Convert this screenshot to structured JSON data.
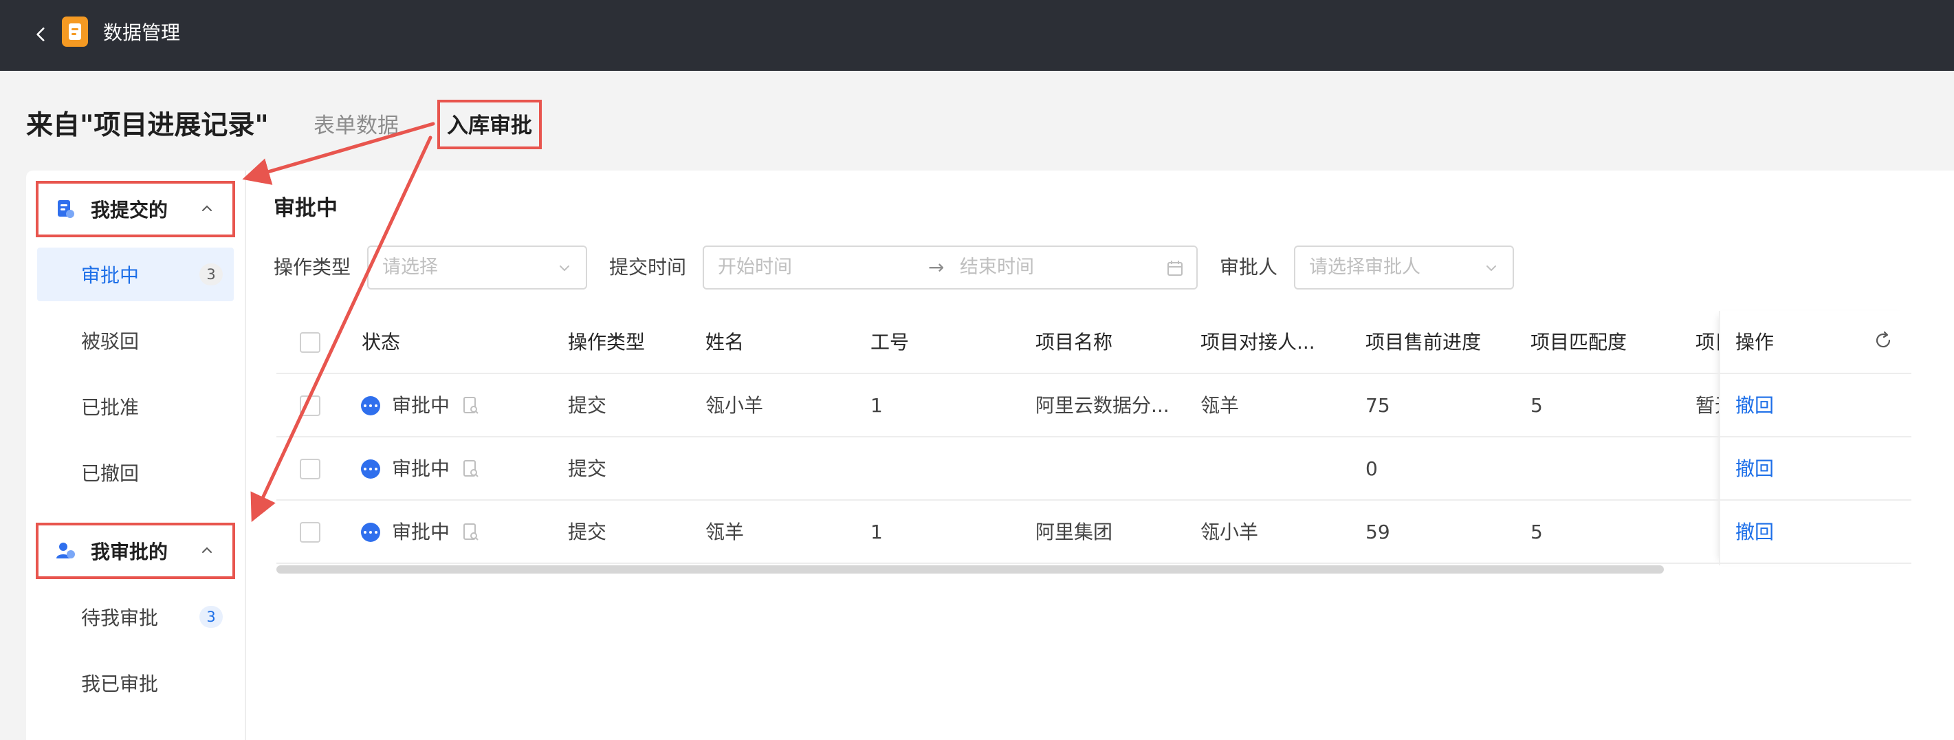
{
  "header": {
    "title": "数据管理",
    "back_icon": "chevron-left-icon",
    "logo_icon": "document-app-icon"
  },
  "page": {
    "title": "来自\"项目进展记录\"",
    "tabs": [
      {
        "label": "表单数据",
        "active": false
      },
      {
        "label": "入库审批",
        "active": true
      }
    ]
  },
  "sidebar": {
    "groups": [
      {
        "label": "我提交的",
        "icon": "submit-doc-icon",
        "expanded": true,
        "items": [
          {
            "label": "审批中",
            "count": "3",
            "active": true
          },
          {
            "label": "被驳回"
          },
          {
            "label": "已批准"
          },
          {
            "label": "已撤回"
          }
        ]
      },
      {
        "label": "我审批的",
        "icon": "approver-user-icon",
        "expanded": true,
        "items": [
          {
            "label": "待我审批",
            "count": "3"
          },
          {
            "label": "我已审批"
          }
        ]
      }
    ]
  },
  "main": {
    "section_title": "审批中",
    "filters": {
      "op_type_label": "操作类型",
      "op_type_placeholder": "请选择",
      "submit_time_label": "提交时间",
      "start_placeholder": "开始时间",
      "range_sep": "→",
      "end_placeholder": "结束时间",
      "approver_label": "审批人",
      "approver_placeholder": "请选择审批人"
    },
    "table": {
      "headers": [
        "状态",
        "操作类型",
        "姓名",
        "工号",
        "项目名称",
        "项目对接人...",
        "项目售前进度",
        "项目匹配度",
        "项目",
        "操作"
      ],
      "rows": [
        {
          "status": "审批中",
          "op_type": "提交",
          "name": "瓴小羊",
          "emp_no": "1",
          "project": "阿里云数据分...",
          "contact": "瓴羊",
          "progress": "75",
          "match": "5",
          "extra": "暂无",
          "action": "撤回"
        },
        {
          "status": "审批中",
          "op_type": "提交",
          "name": "",
          "emp_no": "",
          "project": "",
          "contact": "",
          "progress": "0",
          "match": "",
          "extra": "",
          "action": "撤回"
        },
        {
          "status": "审批中",
          "op_type": "提交",
          "name": "瓴羊",
          "emp_no": "1",
          "project": "阿里集团",
          "contact": "瓴小羊",
          "progress": "59",
          "match": "5",
          "extra": "",
          "action": "撤回"
        }
      ]
    }
  },
  "colors": {
    "accent": "#1d6fe8",
    "annotation": "#e8554e",
    "topbar": "#2c2f36",
    "logo": "#f59a23"
  }
}
